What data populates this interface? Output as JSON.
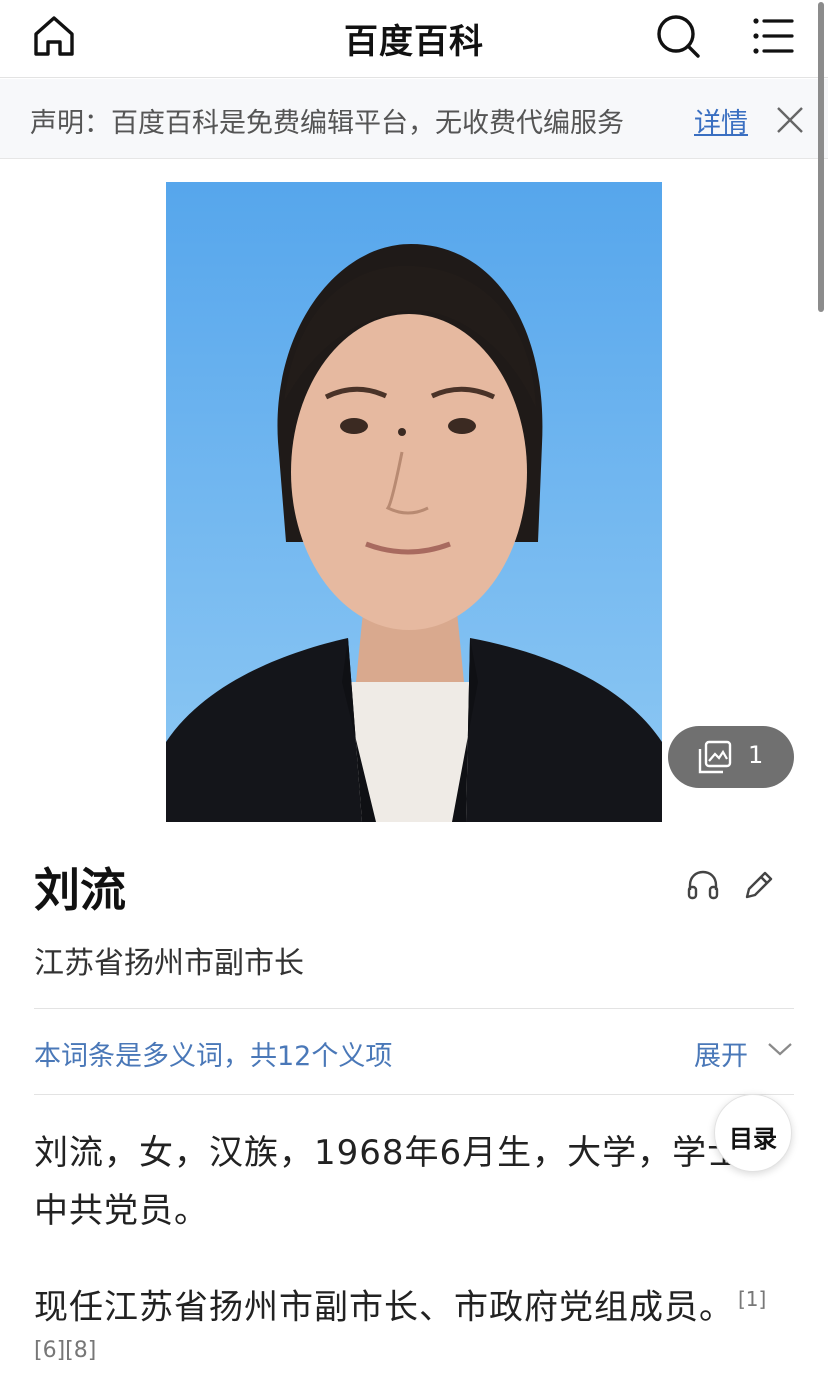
{
  "header": {
    "title": "百度百科",
    "home_icon": "home-icon",
    "search_icon": "search-icon",
    "menu_icon": "menu-icon"
  },
  "notice": {
    "text": "声明：百度百科是免费编辑平台，无收费代编服务",
    "link": "详情",
    "close_icon": "close-icon"
  },
  "photo": {
    "album_count": "1",
    "album_icon": "gallery-icon"
  },
  "entry": {
    "title": "刘流",
    "subtitle": "江苏省扬州市副市长",
    "listen_icon": "headphones-icon",
    "edit_icon": "pencil-icon"
  },
  "polysemy": {
    "text": "本词条是多义词，共12个义项",
    "expand_label": "展开"
  },
  "content": {
    "para1": "刘流，女，汉族，1968年6月生，大学，学士，中共党员。",
    "para2": "现任江苏省扬州市副市长、市政府党组成员。",
    "para2_ref": "[1]",
    "para2_refs_more": "[6][8]"
  },
  "toc": {
    "label": "目录"
  },
  "colors": {
    "link": "#3a6fc1",
    "poly": "#4a78b8",
    "photo_bg": "#5aa9ea"
  }
}
